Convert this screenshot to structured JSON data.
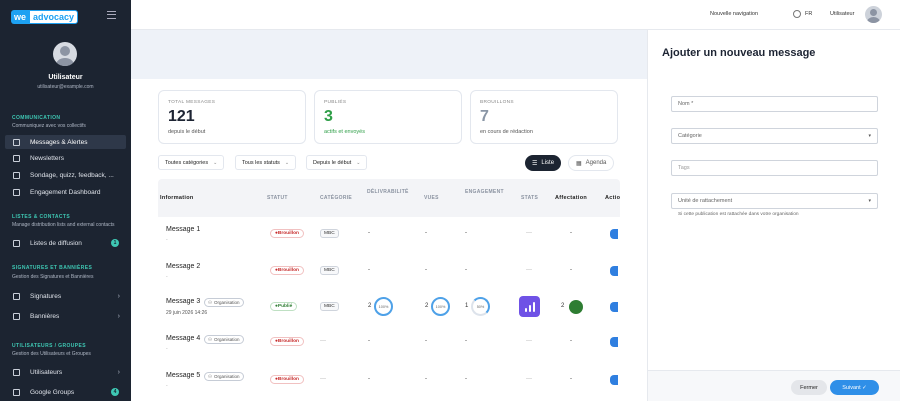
{
  "sidebar": {
    "logo_we": "we",
    "logo_adv": "advocacy",
    "user_name": "Utilisateur",
    "user_email": "utilisateur@example.com",
    "sections": [
      {
        "title": "COMMUNICATION",
        "subtitle": "Communiquez avec vos collectifs"
      },
      {
        "title": "LISTES & CONTACTS",
        "subtitle": "Manage distribution lists and external contacts"
      },
      {
        "title": "SIGNATURES ET BANNIÈRES",
        "subtitle": "Gestion des Signatures et Bannières"
      },
      {
        "title": "UTILISATEURS / GROUPES",
        "subtitle": "Gestion des Utilisateurs et Groupes"
      }
    ],
    "items": [
      {
        "label": "Messages & Alertes"
      },
      {
        "label": "Newsletters"
      },
      {
        "label": "Sondage, quizz, feedback, ..."
      },
      {
        "label": "Engagement Dashboard"
      },
      {
        "label": "Listes de diffusion",
        "badge": "1"
      },
      {
        "label": "Signatures"
      },
      {
        "label": "Bannières"
      },
      {
        "label": "Utilisateurs"
      },
      {
        "label": "Google Groups",
        "badge": "4"
      }
    ]
  },
  "topbar": {
    "new_nav": "Nouvelle navigation",
    "lang": "FR",
    "user": "Utilisateur"
  },
  "stats": [
    {
      "label": "TOTAL MESSAGES",
      "value": "121",
      "sub": "depuis le début"
    },
    {
      "label": "PUBLIÉS",
      "value": "3",
      "sub": "actifs et envoyés"
    },
    {
      "label": "BROUILLONS",
      "value": "7",
      "sub": "en cours de rédaction"
    }
  ],
  "filters": {
    "categories": "Toutes catégories",
    "statuses": "Tous les statuts",
    "since": "Depuis le début",
    "list": "Liste",
    "agenda": "Agenda"
  },
  "table": {
    "headers": {
      "info": "Information",
      "status": "STATUT",
      "category": "CATÉGORIE",
      "deliverability": "DÉLIVRABILITÉ",
      "views": "VUES",
      "engagement": "ENGAGEMENT",
      "stats": "STATS",
      "assignment": "Affectation",
      "actions": "Actio"
    },
    "rows": [
      {
        "name": "Message 1",
        "sub": "-",
        "status": "Brouillon",
        "category": "MBC",
        "deliv": "-",
        "views": "-",
        "eng": "-",
        "stats": "—",
        "assign": "-"
      },
      {
        "name": "Message 2",
        "sub": "-",
        "status": "Brouillon",
        "category": "MBC",
        "deliv": "-",
        "views": "-",
        "eng": "-",
        "stats": "—",
        "assign": "-"
      },
      {
        "name": "Message 3",
        "org": "Organisation",
        "date": "29 juin 2026 14:26",
        "status": "Publié",
        "category": "MBC",
        "deliv": "2",
        "deliv_pct": "100%",
        "views": "2",
        "views_pct": "100%",
        "eng": "1",
        "eng_pct": "50%",
        "assign": "2"
      },
      {
        "name": "Message 4",
        "org": "Organisation",
        "sub": "-",
        "status": "Brouillon",
        "category": "—",
        "deliv": "-",
        "views": "-",
        "eng": "-",
        "stats": "—",
        "assign": "-"
      },
      {
        "name": "Message 5",
        "org": "Organisation",
        "sub": "-",
        "status": "Brouillon",
        "category": "—",
        "deliv": "-",
        "views": "-",
        "eng": "-",
        "stats": "—",
        "assign": "-"
      }
    ]
  },
  "panel": {
    "title": "Ajouter un nouveau message",
    "name_placeholder": "Nom *",
    "category": "Catégorie",
    "tags": "Tags",
    "unit": "Unité de rattachement",
    "help": "Si cette publication est rattachée dans votre organisation",
    "close": "Fermer",
    "next": "Suivant ✓"
  }
}
